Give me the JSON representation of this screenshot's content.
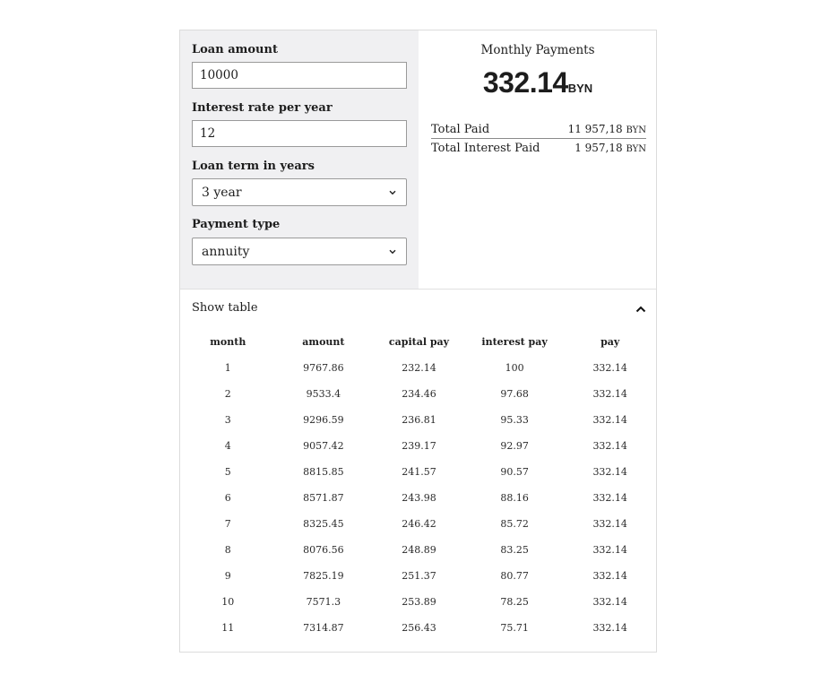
{
  "form": {
    "loan_amount_label": "Loan amount",
    "loan_amount_value": "10000",
    "interest_rate_label": "Interest rate per year",
    "interest_rate_value": "12",
    "loan_term_label": "Loan term in years",
    "loan_term_value": "3 year",
    "payment_type_label": "Payment type",
    "payment_type_value": "annuity"
  },
  "results": {
    "monthly_payments_title": "Monthly Payments",
    "monthly_amount": "332.14",
    "currency": "BYN",
    "total_paid_label": "Total Paid",
    "total_paid_value": "11 957,18",
    "total_interest_label": "Total Interest Paid",
    "total_interest_value": "1 957,18"
  },
  "table_toggle": {
    "label": "Show table",
    "icon": "chevron-up-icon"
  },
  "schedule": {
    "headers": [
      "month",
      "amount",
      "capital pay",
      "interest pay",
      "pay"
    ],
    "rows": [
      [
        "1",
        "9767.86",
        "232.14",
        "100",
        "332.14"
      ],
      [
        "2",
        "9533.4",
        "234.46",
        "97.68",
        "332.14"
      ],
      [
        "3",
        "9296.59",
        "236.81",
        "95.33",
        "332.14"
      ],
      [
        "4",
        "9057.42",
        "239.17",
        "92.97",
        "332.14"
      ],
      [
        "5",
        "8815.85",
        "241.57",
        "90.57",
        "332.14"
      ],
      [
        "6",
        "8571.87",
        "243.98",
        "88.16",
        "332.14"
      ],
      [
        "7",
        "8325.45",
        "246.42",
        "85.72",
        "332.14"
      ],
      [
        "8",
        "8076.56",
        "248.89",
        "83.25",
        "332.14"
      ],
      [
        "9",
        "7825.19",
        "251.37",
        "80.77",
        "332.14"
      ],
      [
        "10",
        "7571.3",
        "253.89",
        "78.25",
        "332.14"
      ],
      [
        "11",
        "7314.87",
        "256.43",
        "75.71",
        "332.14"
      ]
    ]
  }
}
